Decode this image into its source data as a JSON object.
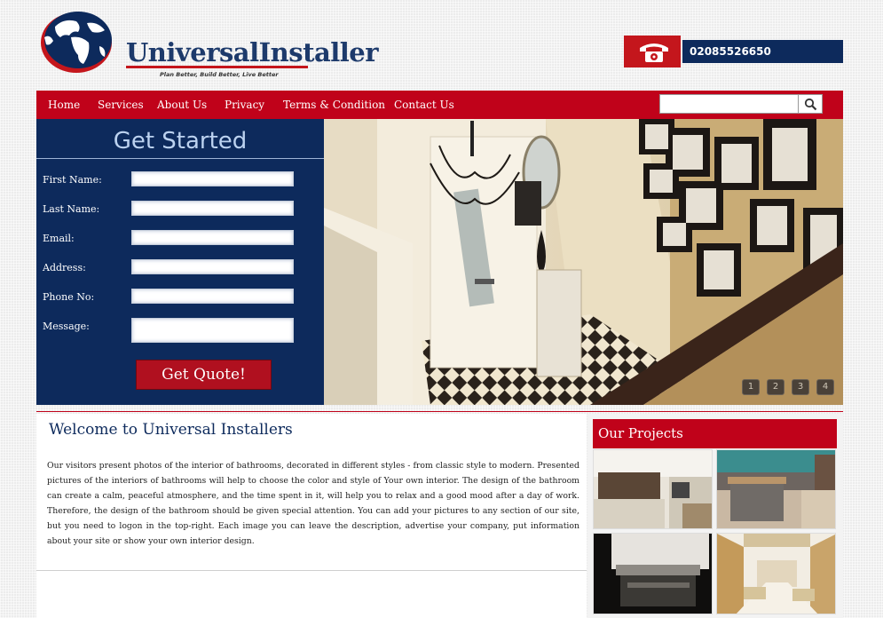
{
  "brand": {
    "name_part1": "Universal",
    "name_part2": "Installer",
    "tagline": "Plan Better, Build Better, Live Better",
    "accent": "#c0021a",
    "navy": "#0d2a5c"
  },
  "contact": {
    "phone_icon": "telephone-icon",
    "phone": "02085526650"
  },
  "nav": {
    "items": [
      {
        "label": "Home"
      },
      {
        "label": "Services"
      },
      {
        "label": "About Us"
      },
      {
        "label": "Privacy"
      },
      {
        "label": "Terms & Condition"
      },
      {
        "label": "Contact Us"
      }
    ],
    "search": {
      "value": "",
      "icon": "search-icon"
    }
  },
  "form": {
    "title": "Get Started",
    "fields": [
      {
        "label": "First Name:",
        "value": ""
      },
      {
        "label": "Last Name:",
        "value": ""
      },
      {
        "label": "Email:",
        "value": ""
      },
      {
        "label": "Address:",
        "value": ""
      },
      {
        "label": "Phone No:",
        "value": ""
      },
      {
        "label": "Message:",
        "value": ""
      }
    ],
    "submit_label": "Get Quote!"
  },
  "hero": {
    "pager": [
      "1",
      "2",
      "3",
      "4"
    ]
  },
  "welcome": {
    "title": "Welcome to Universal Installers",
    "body": "Our visitors present photos of the interior of bathrooms, decorated in different styles - from classic style to modern. Presented pictures of the interiors of bathrooms will help to choose the color and style of Your own interior. The design of the bathroom can create a calm, peaceful atmosphere, and the time spent in it, will help you to relax and a good mood after a day of work. Therefore, the design of the bathroom should be given special attention. You can add your pictures to any section of our site, but you need to logon in the top-right. Each image you can leave the description, advertise your company, put information about your site or show your own interior design."
  },
  "projects": {
    "title": "Our Projects"
  }
}
